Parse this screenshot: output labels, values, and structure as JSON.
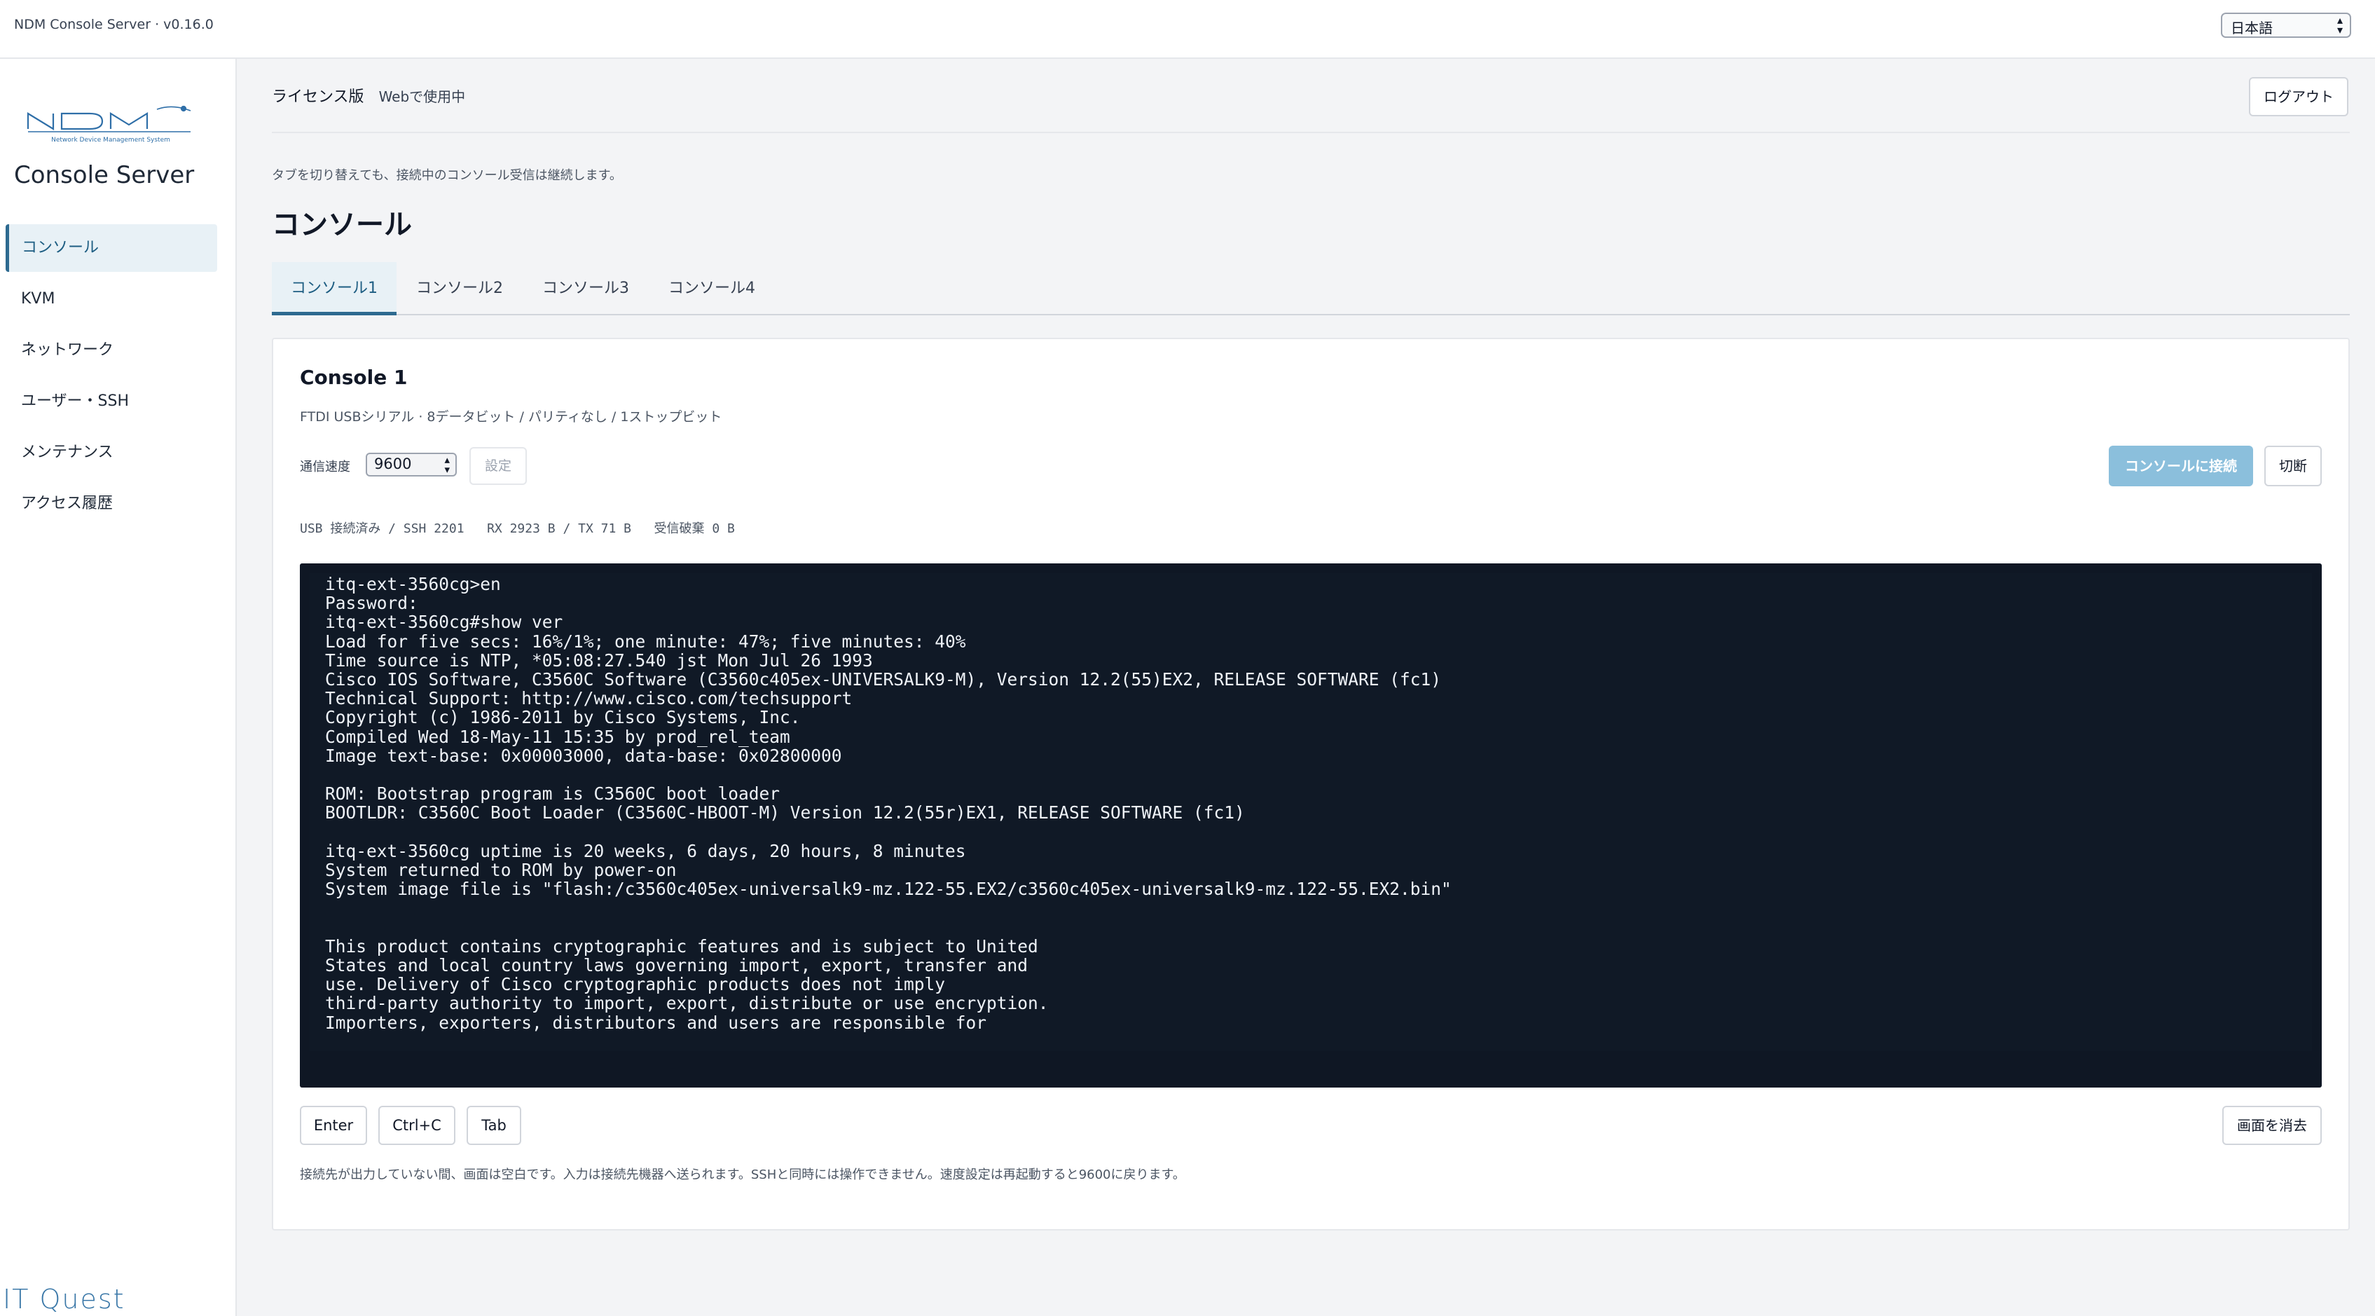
{
  "app": {
    "title": "NDM Console Server · v0.16.0",
    "language": "日本語"
  },
  "sidebar": {
    "logo_text": "NDM",
    "logo_subtitle": "Network Device Management System",
    "brand": "Console Server",
    "items": [
      {
        "label": "コンソール",
        "active": true
      },
      {
        "label": "KVM",
        "active": false
      },
      {
        "label": "ネットワーク",
        "active": false
      },
      {
        "label": "ユーザー・SSH",
        "active": false
      },
      {
        "label": "メンテナンス",
        "active": false
      },
      {
        "label": "アクセス履歴",
        "active": false
      }
    ],
    "footer_logo": "IT Quest"
  },
  "header": {
    "license_label": "ライセンス版",
    "license_value": "Webで使用中",
    "logout": "ログアウト"
  },
  "main": {
    "notice": "タブを切り替えても、接続中のコンソール受信は継続します。",
    "title": "コンソール",
    "tabs": [
      {
        "label": "コンソール1",
        "active": true
      },
      {
        "label": "コンソール2",
        "active": false
      },
      {
        "label": "コンソール3",
        "active": false
      },
      {
        "label": "コンソール4",
        "active": false
      }
    ]
  },
  "console": {
    "title": "Console 1",
    "serial_info": "FTDI USBシリアル · 8データビット / パリティなし / 1ストップビット",
    "baud_label": "通信速度",
    "baud_value": "9600",
    "set_button": "設定",
    "connect_button": "コンソールに接続",
    "disconnect_button": "切断",
    "status": {
      "connection": "USB 接続済み / SSH 2201",
      "traffic": "RX 2923 B / TX 71 B",
      "dropped": "受信破棄 0 B"
    },
    "terminal_output": "itq-ext-3560cg>en\nPassword:\nitq-ext-3560cg#show ver\nLoad for five secs: 16%/1%; one minute: 47%; five minutes: 40%\nTime source is NTP, *05:08:27.540 jst Mon Jul 26 1993\nCisco IOS Software, C3560C Software (C3560c405ex-UNIVERSALK9-M), Version 12.2(55)EX2, RELEASE SOFTWARE (fc1)\nTechnical Support: http://www.cisco.com/techsupport\nCopyright (c) 1986-2011 by Cisco Systems, Inc.\nCompiled Wed 18-May-11 15:35 by prod_rel_team\nImage text-base: 0x00003000, data-base: 0x02800000\n\nROM: Bootstrap program is C3560C boot loader\nBOOTLDR: C3560C Boot Loader (C3560C-HBOOT-M) Version 12.2(55r)EX1, RELEASE SOFTWARE (fc1)\n\nitq-ext-3560cg uptime is 20 weeks, 6 days, 20 hours, 8 minutes\nSystem returned to ROM by power-on\nSystem image file is \"flash:/c3560c405ex-universalk9-mz.122-55.EX2/c3560c405ex-universalk9-mz.122-55.EX2.bin\"\n\n\nThis product contains cryptographic features and is subject to United\nStates and local country laws governing import, export, transfer and\nuse. Delivery of Cisco cryptographic products does not imply\nthird-party authority to import, export, distribute or use encryption.\nImporters, exporters, distributors and users are responsible for",
    "keys": [
      "Enter",
      "Ctrl+C",
      "Tab"
    ],
    "clear_button": "画面を消去",
    "footnote": "接続先が出力していない間、画面は空白です。入力は接続先機器へ送られます。SSHと同時には操作できません。速度設定は再起動すると9600に戻ります。"
  },
  "colors": {
    "accent": "#2d6a90",
    "accent_bg": "#e8f1f6",
    "connect_button": "#8bbfdc",
    "terminal_bg": "#0f1724",
    "terminal_text": "#eef2f7"
  }
}
